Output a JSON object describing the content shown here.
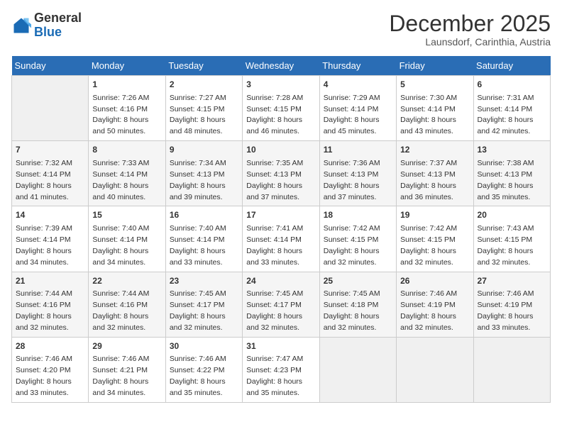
{
  "logo": {
    "general": "General",
    "blue": "Blue"
  },
  "title": "December 2025",
  "subtitle": "Launsdorf, Carinthia, Austria",
  "days_of_week": [
    "Sunday",
    "Monday",
    "Tuesday",
    "Wednesday",
    "Thursday",
    "Friday",
    "Saturday"
  ],
  "weeks": [
    [
      {
        "day": "",
        "info": ""
      },
      {
        "day": "1",
        "info": "Sunrise: 7:26 AM\nSunset: 4:16 PM\nDaylight: 8 hours\nand 50 minutes."
      },
      {
        "day": "2",
        "info": "Sunrise: 7:27 AM\nSunset: 4:15 PM\nDaylight: 8 hours\nand 48 minutes."
      },
      {
        "day": "3",
        "info": "Sunrise: 7:28 AM\nSunset: 4:15 PM\nDaylight: 8 hours\nand 46 minutes."
      },
      {
        "day": "4",
        "info": "Sunrise: 7:29 AM\nSunset: 4:14 PM\nDaylight: 8 hours\nand 45 minutes."
      },
      {
        "day": "5",
        "info": "Sunrise: 7:30 AM\nSunset: 4:14 PM\nDaylight: 8 hours\nand 43 minutes."
      },
      {
        "day": "6",
        "info": "Sunrise: 7:31 AM\nSunset: 4:14 PM\nDaylight: 8 hours\nand 42 minutes."
      }
    ],
    [
      {
        "day": "7",
        "info": "Sunrise: 7:32 AM\nSunset: 4:14 PM\nDaylight: 8 hours\nand 41 minutes."
      },
      {
        "day": "8",
        "info": "Sunrise: 7:33 AM\nSunset: 4:14 PM\nDaylight: 8 hours\nand 40 minutes."
      },
      {
        "day": "9",
        "info": "Sunrise: 7:34 AM\nSunset: 4:13 PM\nDaylight: 8 hours\nand 39 minutes."
      },
      {
        "day": "10",
        "info": "Sunrise: 7:35 AM\nSunset: 4:13 PM\nDaylight: 8 hours\nand 37 minutes."
      },
      {
        "day": "11",
        "info": "Sunrise: 7:36 AM\nSunset: 4:13 PM\nDaylight: 8 hours\nand 37 minutes."
      },
      {
        "day": "12",
        "info": "Sunrise: 7:37 AM\nSunset: 4:13 PM\nDaylight: 8 hours\nand 36 minutes."
      },
      {
        "day": "13",
        "info": "Sunrise: 7:38 AM\nSunset: 4:13 PM\nDaylight: 8 hours\nand 35 minutes."
      }
    ],
    [
      {
        "day": "14",
        "info": "Sunrise: 7:39 AM\nSunset: 4:14 PM\nDaylight: 8 hours\nand 34 minutes."
      },
      {
        "day": "15",
        "info": "Sunrise: 7:40 AM\nSunset: 4:14 PM\nDaylight: 8 hours\nand 34 minutes."
      },
      {
        "day": "16",
        "info": "Sunrise: 7:40 AM\nSunset: 4:14 PM\nDaylight: 8 hours\nand 33 minutes."
      },
      {
        "day": "17",
        "info": "Sunrise: 7:41 AM\nSunset: 4:14 PM\nDaylight: 8 hours\nand 33 minutes."
      },
      {
        "day": "18",
        "info": "Sunrise: 7:42 AM\nSunset: 4:15 PM\nDaylight: 8 hours\nand 32 minutes."
      },
      {
        "day": "19",
        "info": "Sunrise: 7:42 AM\nSunset: 4:15 PM\nDaylight: 8 hours\nand 32 minutes."
      },
      {
        "day": "20",
        "info": "Sunrise: 7:43 AM\nSunset: 4:15 PM\nDaylight: 8 hours\nand 32 minutes."
      }
    ],
    [
      {
        "day": "21",
        "info": "Sunrise: 7:44 AM\nSunset: 4:16 PM\nDaylight: 8 hours\nand 32 minutes."
      },
      {
        "day": "22",
        "info": "Sunrise: 7:44 AM\nSunset: 4:16 PM\nDaylight: 8 hours\nand 32 minutes."
      },
      {
        "day": "23",
        "info": "Sunrise: 7:45 AM\nSunset: 4:17 PM\nDaylight: 8 hours\nand 32 minutes."
      },
      {
        "day": "24",
        "info": "Sunrise: 7:45 AM\nSunset: 4:17 PM\nDaylight: 8 hours\nand 32 minutes."
      },
      {
        "day": "25",
        "info": "Sunrise: 7:45 AM\nSunset: 4:18 PM\nDaylight: 8 hours\nand 32 minutes."
      },
      {
        "day": "26",
        "info": "Sunrise: 7:46 AM\nSunset: 4:19 PM\nDaylight: 8 hours\nand 32 minutes."
      },
      {
        "day": "27",
        "info": "Sunrise: 7:46 AM\nSunset: 4:19 PM\nDaylight: 8 hours\nand 33 minutes."
      }
    ],
    [
      {
        "day": "28",
        "info": "Sunrise: 7:46 AM\nSunset: 4:20 PM\nDaylight: 8 hours\nand 33 minutes."
      },
      {
        "day": "29",
        "info": "Sunrise: 7:46 AM\nSunset: 4:21 PM\nDaylight: 8 hours\nand 34 minutes."
      },
      {
        "day": "30",
        "info": "Sunrise: 7:46 AM\nSunset: 4:22 PM\nDaylight: 8 hours\nand 35 minutes."
      },
      {
        "day": "31",
        "info": "Sunrise: 7:47 AM\nSunset: 4:23 PM\nDaylight: 8 hours\nand 35 minutes."
      },
      {
        "day": "",
        "info": ""
      },
      {
        "day": "",
        "info": ""
      },
      {
        "day": "",
        "info": ""
      }
    ]
  ]
}
